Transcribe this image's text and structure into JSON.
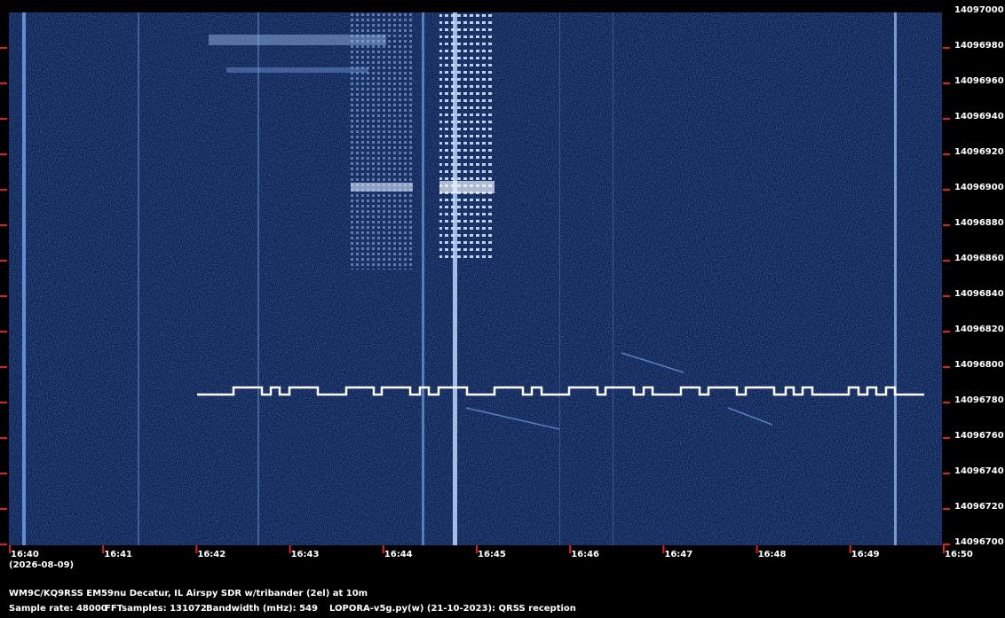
{
  "spectrogram": {
    "frequency_axis": {
      "labels": [
        "14097000",
        "14096980",
        "14096960",
        "14096940",
        "14096920",
        "14096900",
        "14096880",
        "14096860",
        "14096840",
        "14096820",
        "14096800",
        "14096780",
        "14096760",
        "14096740",
        "14096720",
        "14096700"
      ]
    },
    "time_axis": {
      "labels": [
        "16:40",
        "16:41",
        "16:42",
        "16:43",
        "16:44",
        "16:45",
        "16:46",
        "16:47",
        "16:48",
        "16:49",
        "16:50"
      ],
      "date": "(2026-08-09)"
    },
    "colors": {
      "background": "#0b1f4f",
      "tick": "#e02020",
      "signal_trace": "#ffffff"
    }
  },
  "footer": {
    "station": "WM9C/KQ9RSS EM59nu Decatur, IL  Airspy SDR w/tribander (2el) at 10m",
    "sample_rate": "Sample rate: 48000",
    "fft_samples": "FFTsamples: 131072",
    "bandwidth": "Bandwidth (mHz): 549",
    "software": "LOPORA-v5g.py(w) (21-10-2023): QRSS reception"
  }
}
